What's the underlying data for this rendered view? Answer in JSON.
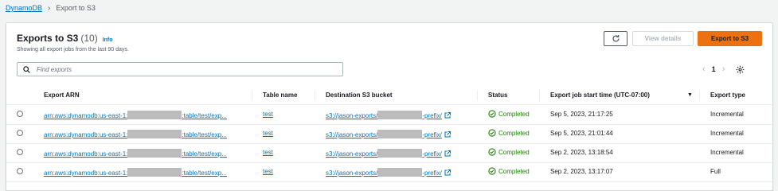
{
  "breadcrumb": {
    "root": "DynamoDB",
    "current": "Export to S3"
  },
  "header": {
    "title": "Exports to S3",
    "count": "(10)",
    "info": "Info",
    "subtitle": "Showing all export jobs from the last 90 days."
  },
  "actions": {
    "view_details": "View details",
    "export": "Export to S3"
  },
  "search": {
    "placeholder": "Find exports"
  },
  "pagination": {
    "page": "1"
  },
  "columns": {
    "arn": "Export ARN",
    "table": "Table name",
    "bucket": "Destination S3 bucket",
    "status": "Status",
    "start_time": "Export job start time (UTC-07:00)",
    "type": "Export type"
  },
  "rows": [
    {
      "arn_prefix": "arn:aws:dynamodb:us-east-1:",
      "arn_suffix": ":table/test/exp...",
      "table": "test",
      "bucket_prefix": "s3://jason-exports/",
      "bucket_suffix": "-prefix/",
      "status": "Completed",
      "start_time": "Sep 5, 2023, 21:17:25",
      "type": "Incremental"
    },
    {
      "arn_prefix": "arn:aws:dynamodb:us-east-1:",
      "arn_suffix": ":table/test/exp...",
      "table": "test",
      "bucket_prefix": "s3://jason-exports/",
      "bucket_suffix": "-prefix/",
      "status": "Completed",
      "start_time": "Sep 5, 2023, 21:01:44",
      "type": "Incremental"
    },
    {
      "arn_prefix": "arn:aws:dynamodb:us-east-1:",
      "arn_suffix": ":table/test/exp...",
      "table": "test",
      "bucket_prefix": "s3://jason-exports/",
      "bucket_suffix": "-prefix/",
      "status": "Completed",
      "start_time": "Sep 2, 2023, 13:18:54",
      "type": "Incremental"
    },
    {
      "arn_prefix": "arn:aws:dynamodb:us-east-1:",
      "arn_suffix": ":table/test/exp...",
      "table": "test",
      "bucket_prefix": "s3://jason-exports/",
      "bucket_suffix": "-prefix/",
      "status": "Completed",
      "start_time": "Sep 2, 2023, 13:17:07",
      "type": "Full"
    }
  ],
  "colors": {
    "link": "#0073bb",
    "primary": "#ec7211",
    "success": "#1d8102"
  },
  "icons": [
    "chevron-right-icon",
    "refresh-icon",
    "search-icon",
    "chevron-left-icon",
    "gear-icon",
    "sort-down-icon",
    "check-circle-icon",
    "external-link-icon"
  ]
}
